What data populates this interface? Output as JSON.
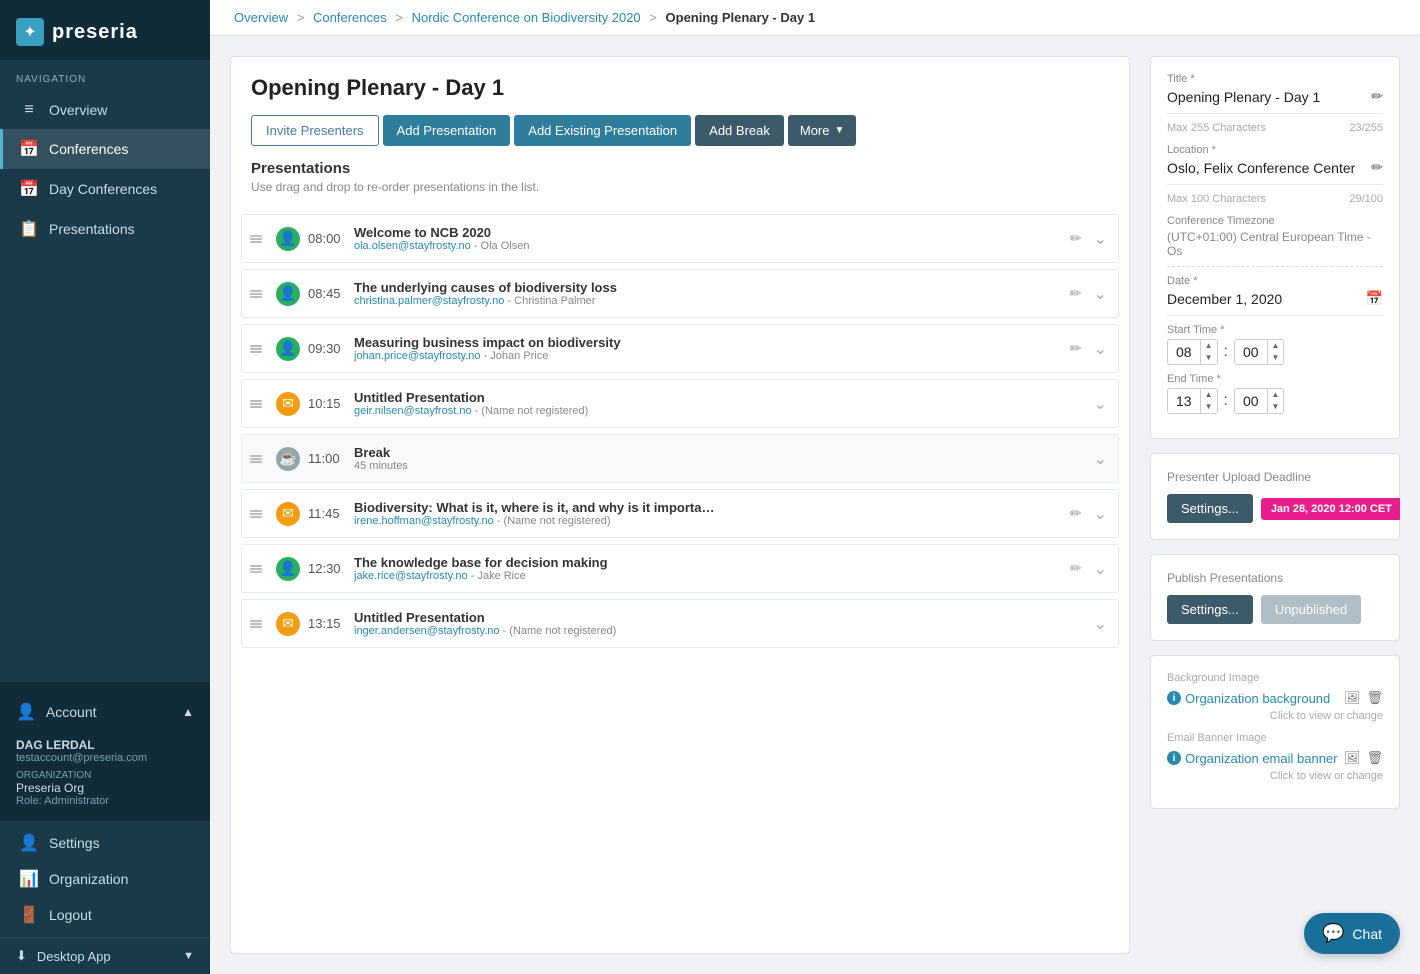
{
  "sidebar": {
    "logo": "preseria",
    "nav_label": "NAVIGATION",
    "items": [
      {
        "id": "overview",
        "label": "Overview",
        "icon": "≡",
        "active": false
      },
      {
        "id": "conferences",
        "label": "Conferences",
        "icon": "📅",
        "active": true
      },
      {
        "id": "day-conferences",
        "label": "Day Conferences",
        "icon": "📅",
        "active": false
      },
      {
        "id": "presentations",
        "label": "Presentations",
        "icon": "📋",
        "active": false
      }
    ],
    "account": {
      "label": "Account",
      "name": "DAG LERDAL",
      "email": "testaccount@preseria.com",
      "org_label": "ORGANIZATION",
      "org": "Preseria Org",
      "role": "Role: Administrator"
    },
    "bottom_items": [
      {
        "id": "settings",
        "label": "Settings",
        "icon": "👤"
      },
      {
        "id": "organization",
        "label": "Organization",
        "icon": "📊"
      },
      {
        "id": "logout",
        "label": "Logout",
        "icon": "🚪"
      }
    ],
    "desktop_app": "Desktop App"
  },
  "breadcrumb": {
    "items": [
      {
        "label": "Overview",
        "link": true
      },
      {
        "label": "Conferences",
        "link": true
      },
      {
        "label": "Nordic Conference on Biodiversity 2020",
        "link": true
      },
      {
        "label": "Opening Plenary - Day 1",
        "link": false
      }
    ]
  },
  "main": {
    "title": "Opening Plenary - Day 1",
    "toolbar": {
      "invite_presenters": "Invite Presenters",
      "add_presentation": "Add Presentation",
      "add_existing": "Add Existing Presentation",
      "add_break": "Add Break",
      "more": "More"
    },
    "presentations_section": {
      "title": "Presentations",
      "hint": "Use drag and drop to re-order presentations in the list."
    },
    "presentations": [
      {
        "id": 1,
        "time": "08:00",
        "title": "Welcome to NCB 2020",
        "email": "ola.olsen@stayfrosty.no",
        "presenter": "Ola Olsen",
        "avatar_type": "green",
        "has_edit": true
      },
      {
        "id": 2,
        "time": "08:45",
        "title": "The underlying causes of biodiversity loss",
        "email": "christina.palmer@stayfrosty.no",
        "presenter": "Christina Palmer",
        "avatar_type": "green",
        "has_edit": true
      },
      {
        "id": 3,
        "time": "09:30",
        "title": "Measuring business impact on biodiversity",
        "email": "johan.price@stayfrosty.no",
        "presenter": "Johan Price",
        "avatar_type": "green",
        "has_edit": true
      },
      {
        "id": 4,
        "time": "10:15",
        "title": "Untitled Presentation",
        "email": "geir.nilsen@stayfrost.no",
        "presenter": "(Name not registered)",
        "avatar_type": "yellow",
        "has_edit": false
      },
      {
        "id": 5,
        "time": "11:00",
        "title": "Break",
        "sub": "45 minutes",
        "avatar_type": "break",
        "has_edit": false
      },
      {
        "id": 6,
        "time": "11:45",
        "title": "Biodiversity: What is it, where is it, and why is it importa…",
        "email": "irene.hoffman@stayfrosty.no",
        "presenter": "(Name not registered)",
        "avatar_type": "yellow",
        "has_edit": true
      },
      {
        "id": 7,
        "time": "12:30",
        "title": "The knowledge base for decision making",
        "email": "jake.rice@stayfrosty.no",
        "presenter": "Jake Rice",
        "avatar_type": "green",
        "has_edit": true
      },
      {
        "id": 8,
        "time": "13:15",
        "title": "Untitled Presentation",
        "email": "inger.andersen@stayfrosty.no",
        "presenter": "(Name not registered)",
        "avatar_type": "yellow",
        "has_edit": false
      }
    ]
  },
  "right_panel": {
    "title_label": "Title *",
    "title_value": "Opening Plenary - Day 1",
    "title_max": "Max 255 Characters",
    "title_count": "23/255",
    "location_label": "Location *",
    "location_value": "Oslo, Felix Conference Center",
    "location_max": "Max 100 Characters",
    "location_count": "29/100",
    "timezone_label": "Conference Timezone",
    "timezone_value": "(UTC+01:00) Central European Time - Os",
    "date_label": "Date *",
    "date_value": "December 1, 2020",
    "start_time_label": "Start Time *",
    "start_hour": "08",
    "start_min": "00",
    "end_time_label": "End Time *",
    "end_hour": "13",
    "end_min": "00",
    "presenter_deadline_label": "Presenter Upload Deadline",
    "settings_btn": "Settings...",
    "deadline_badge": "Jan 28, 2020 12:00 CET",
    "publish_label": "Publish Presentations",
    "publish_settings": "Settings...",
    "unpublished": "Unpublished",
    "bg_image_label": "Background Image",
    "bg_link": "Organization background",
    "bg_hint": "Click to view or change",
    "email_banner_label": "Email Banner Image",
    "email_banner_link": "Organization email banner",
    "email_banner_hint": "Click to view or change"
  },
  "chat_btn": "Chat"
}
